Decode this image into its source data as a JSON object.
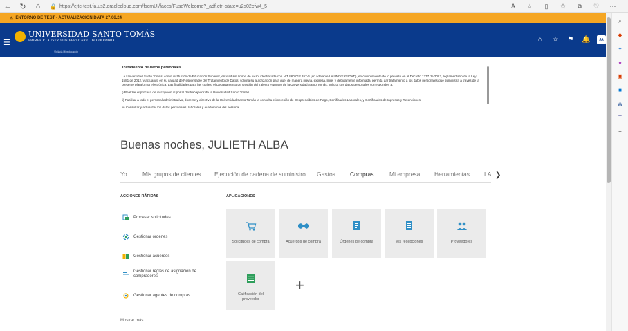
{
  "browser": {
    "url": "https://ejtc-test.fa.us2.oraclecloud.com/fscmUI/faces/FuseWelcome?_adf.ctrl-state=u2s02cfw4_5"
  },
  "banner": {
    "text": "ENTORNO DE TEST - ACTUALIZACIÓN DATA 27.06.24"
  },
  "header": {
    "name": "UNIVERSIDAD SANTO TOMÁS",
    "subtitle": "PRIMER CLAUSTRO UNIVERSITARIO DE COLOMBIA",
    "tagline": "Vigilada Mineducación",
    "avatar_initials": "JA"
  },
  "privacy": {
    "title": "Tratamiento de datos personales",
    "paragraphs": [
      "La Universidad Santo Tomás, como institución de Educación Superior, entidad sin ánimo de lucro, identificada con NIT 860.012.357-6 (en adelante LA UNIVERSIDAD), en cumplimiento de lo previsto en el Decreto 1377 de 2013, reglamentario de la Ley 1581 de 2012, y actuando en su calidad de Responsable del Tratamiento de Datos, solicita su autorización para que, de manera previa, expresa, libre, y debidamente informada, permita dar tratamiento a los datos personales que suministra a través de la presente plataforma electrónica. Las finalidades para las cuales, el Departamento de Gestión del Talento Humano de la Universidad Santo Tomás, solicita sus datos personales corresponden a:",
      "i) Realizar el proceso de inscripción al portal del trabajador de la Universidad Santo Tomás.",
      "ii) Facilitar a todo el personal administrativo, docente y directivo de la Universidad Santo Tomás la consulta e impresión de Desprendibles de Pago, Certificados Laborales, y Certificados de Ingresos y Retenciones.",
      "iii) Consultar y actualizar los datos personales, laborales y académicos del personal."
    ]
  },
  "greeting": "Buenas noches, JULIETH ALBA",
  "tabs": [
    "Yo",
    "Mis grupos de clientes",
    "Ejecución de cadena de suministro",
    "Gastos",
    "Compras",
    "Mi empresa",
    "Herramientas",
    "LA"
  ],
  "quick_actions": {
    "label": "ACCIONES RÁPIDAS",
    "items": [
      "Procesar solicitudes",
      "Gestionar órdenes",
      "Gestionar acuerdos",
      "Gestionar reglas de asignación de compradores",
      "Gestionar agentes de compras"
    ],
    "more": "Mostrar más"
  },
  "apps": {
    "label": "APLICACIONES",
    "tiles": [
      "Solicitudes de compra",
      "Acuerdos de compra",
      "Órdenes de compra",
      "Mis recepciones",
      "Proveedores",
      "Calificación del proveedor"
    ]
  },
  "colors": {
    "header": "#0a3a8c",
    "banner": "#f5a623",
    "tile": "#ebebeb",
    "icon_blue": "#2f8fc6",
    "icon_green": "#2e9e5b"
  }
}
